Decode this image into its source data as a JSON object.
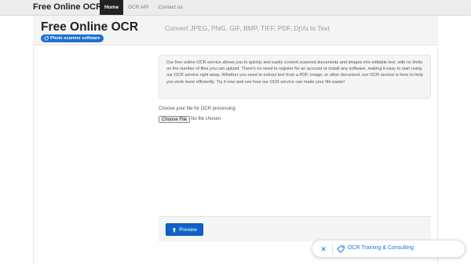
{
  "navbar": {
    "brand": "Free Online OCR",
    "items": [
      {
        "label": "Home",
        "active": true
      },
      {
        "label": "OCR API",
        "active": false
      },
      {
        "label": "Contact us",
        "active": false
      }
    ]
  },
  "hero": {
    "title": "Free Online OCR",
    "subtitle": "Convert JPEG, PNG, GIF, BMP, TIFF, PDF, DjVu to Text",
    "badge_label": "Photo scanner software",
    "badge_icon": "tag-icon",
    "badge_color": "#1e6fd3"
  },
  "intro": {
    "text": "Our free online OCR service allows you to quickly and easily convert scanned documents and images into editable text, with no limits on the number of files you can upload. There's no need to register for an account or install any software, making it easy to start using our OCR service right away. Whether you need to extract text from a PDF, image, or other document, our OCR service is here to help you work more efficiently. Try it now and see how our OCR service can make your life easier!"
  },
  "upload": {
    "label": "Choose your file for OCR processing",
    "button_label": "Choose File",
    "status": "No file chosen"
  },
  "actions": {
    "preview_label": "Preview",
    "preview_icon": "upload-arrow-icon",
    "preview_color": "#0d63c7"
  },
  "chip": {
    "label": "OCR Training & Consulting",
    "close_icon": "close-icon",
    "tag_icon": "tag-icon",
    "accent": "#1a73e8"
  }
}
